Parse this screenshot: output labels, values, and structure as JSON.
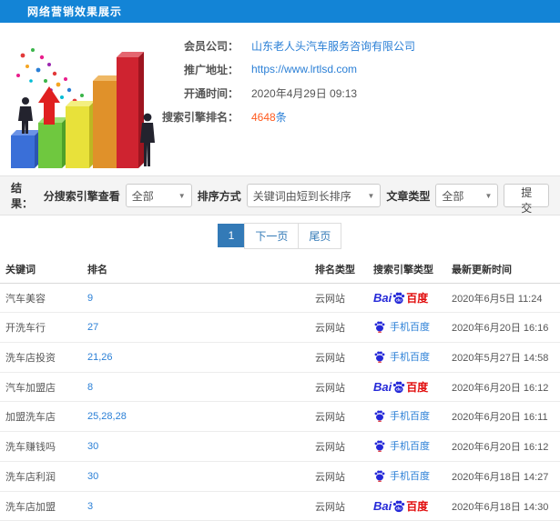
{
  "header": {
    "title": "网络营销效果展示"
  },
  "info": {
    "fields": [
      {
        "label": "会员公司：",
        "value": "山东老人头汽车服务咨询有限公司"
      },
      {
        "label": "推广地址：",
        "value": "https://www.lrtlsd.com"
      },
      {
        "label": "开通时间：",
        "value": "2020年4月29日 09:13"
      },
      {
        "label": "搜索引擎排名：",
        "count": "4648",
        "unit": "条"
      }
    ]
  },
  "filters": {
    "result_label": "结果：",
    "engine_label": "分搜索引擎查看",
    "engine_value": "全部",
    "sort_label": "排序方式",
    "sort_value": "关键词由短到长排序",
    "article_label": "文章类型",
    "article_value": "全部",
    "submit_label": "提交"
  },
  "pagination": {
    "current": "1",
    "next": "下一页",
    "last": "尾页"
  },
  "baidu_logo": {
    "prefix": "Bai",
    "pad_text": "du",
    "suffix": "百度"
  },
  "table": {
    "headers": [
      "关键词",
      "排名",
      "排名类型",
      "搜索引擎类型",
      "最新更新时间"
    ],
    "rows": [
      {
        "keyword": "汽车美容",
        "rank": "9",
        "rank_type": "云网站",
        "engine": "baidu",
        "engine_label": "百度",
        "time": "2020年6月5日 11:24"
      },
      {
        "keyword": "开洗车行",
        "rank": "27",
        "rank_type": "云网站",
        "engine": "mobile-baidu",
        "engine_label": "手机百度",
        "time": "2020年6月20日 16:16"
      },
      {
        "keyword": "洗车店投资",
        "rank": "21,26",
        "rank_type": "云网站",
        "engine": "mobile-baidu",
        "engine_label": "手机百度",
        "time": "2020年5月27日 14:58"
      },
      {
        "keyword": "汽车加盟店",
        "rank": "8",
        "rank_type": "云网站",
        "engine": "baidu",
        "engine_label": "百度",
        "time": "2020年6月20日 16:12"
      },
      {
        "keyword": "加盟洗车店",
        "rank": "25,28,28",
        "rank_type": "云网站",
        "engine": "mobile-baidu",
        "engine_label": "手机百度",
        "time": "2020年6月20日 16:11"
      },
      {
        "keyword": "洗车赚钱吗",
        "rank": "30",
        "rank_type": "云网站",
        "engine": "mobile-baidu",
        "engine_label": "手机百度",
        "time": "2020年6月20日 16:12"
      },
      {
        "keyword": "洗车店利润",
        "rank": "30",
        "rank_type": "云网站",
        "engine": "mobile-baidu",
        "engine_label": "手机百度",
        "time": "2020年6月18日 14:27"
      },
      {
        "keyword": "洗车店加盟",
        "rank": "3",
        "rank_type": "云网站",
        "engine": "baidu",
        "engine_label": "百度",
        "time": "2020年6月18日 14:30"
      }
    ]
  },
  "colors": {
    "header_bg": "#1384d6",
    "link_blue": "#2a7fd6",
    "accent_orange": "#ff5a1e",
    "pagination_active": "#337ab7",
    "baidu_blue": "#2529d8",
    "baidu_red": "#e10c0c"
  }
}
